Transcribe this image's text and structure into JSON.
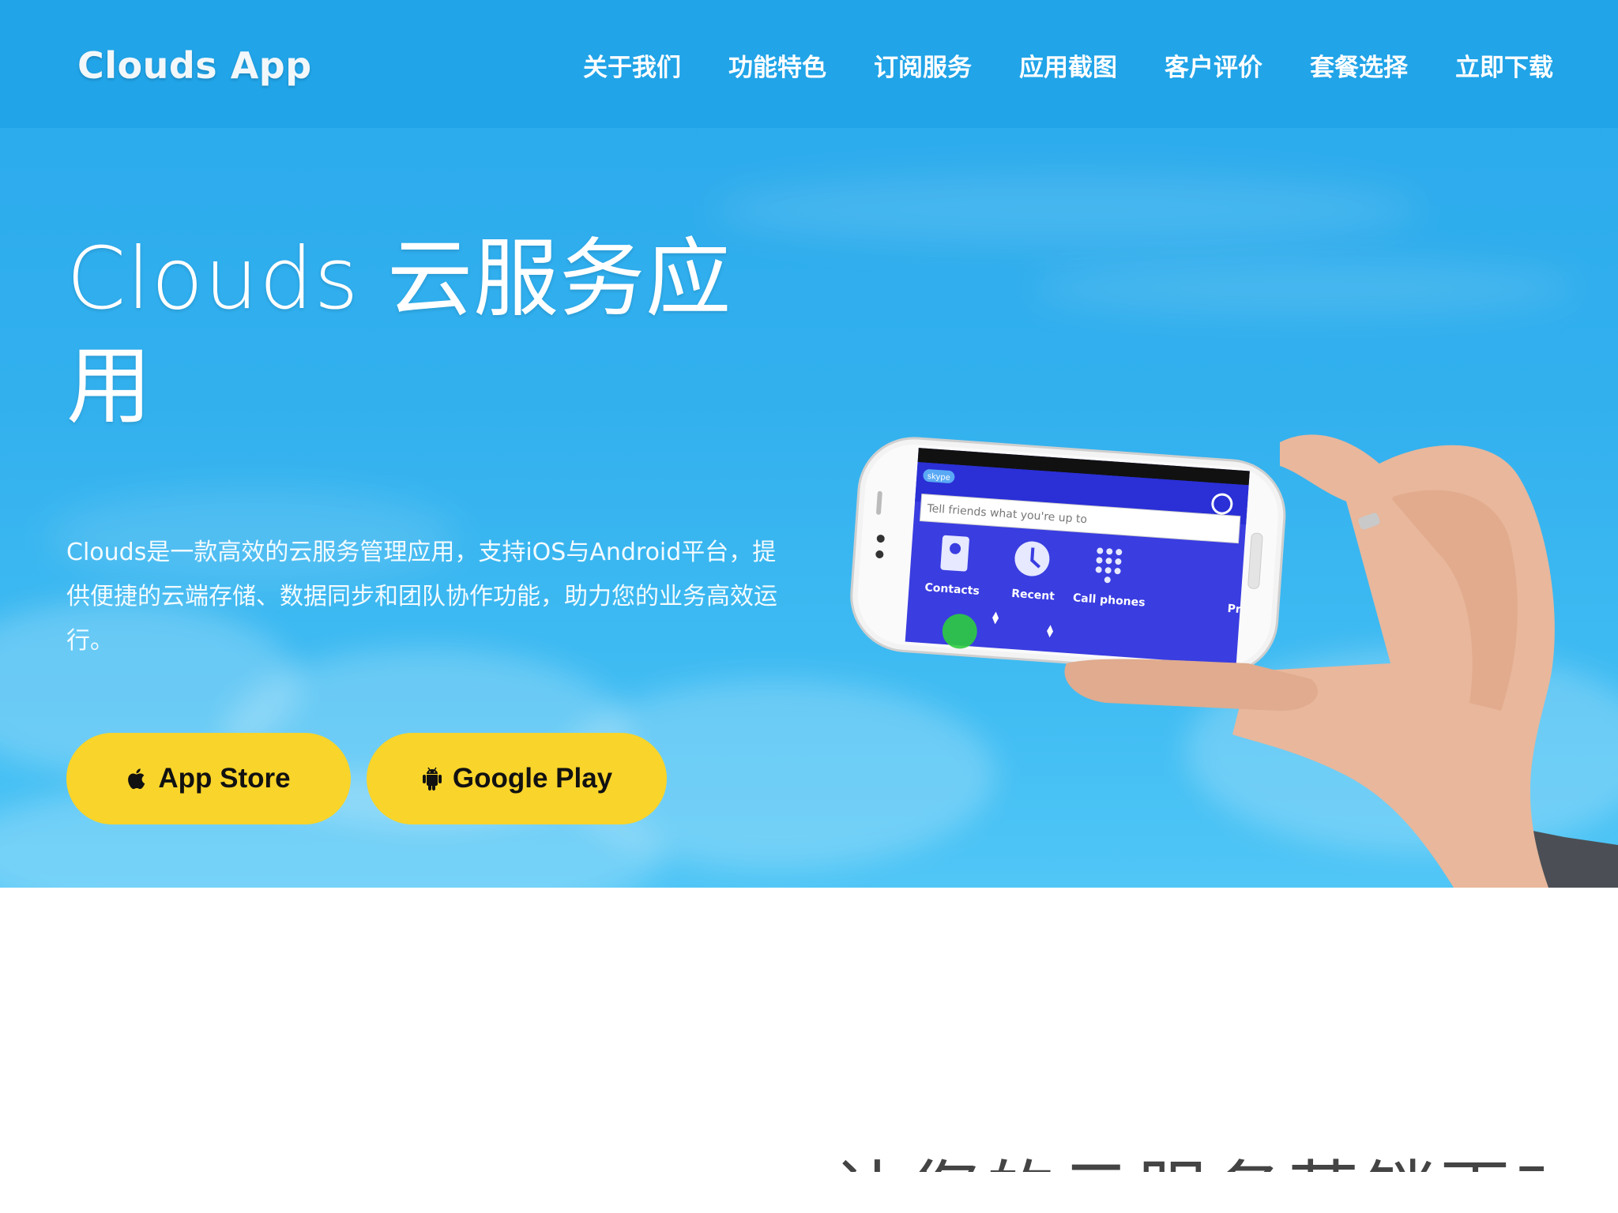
{
  "nav": {
    "brand": "Clouds App",
    "links": [
      "关于我们",
      "功能特色",
      "订阅服务",
      "应用截图",
      "客户评价",
      "套餐选择",
      "立即下载"
    ]
  },
  "hero": {
    "title": "Clouds 云服务应用",
    "description": "Clouds是一款高效的云服务管理应用，支持iOS与Android平台，提供便捷的云端存储、数据同步和团队协作功能，助力您的业务高效运行。",
    "buttons": {
      "appstore": "App Store",
      "googleplay": "Google Play"
    },
    "phone_screen": {
      "app_logo": "skype",
      "status_placeholder": "Tell friends what you're up to",
      "tiles": [
        "Contacts",
        "Recent",
        "Call phones",
        "Pr"
      ]
    }
  },
  "section2": {
    "heading": "让您的云服务营销更高效"
  },
  "colors": {
    "hero_blue": "#2aa9ec",
    "nav_blue": "#21a4e8",
    "button_yellow": "#f9d42a",
    "phone_screen_blue": "#3a3de0"
  },
  "icons": {
    "appstore": "apple-icon",
    "googleplay": "android-icon"
  }
}
